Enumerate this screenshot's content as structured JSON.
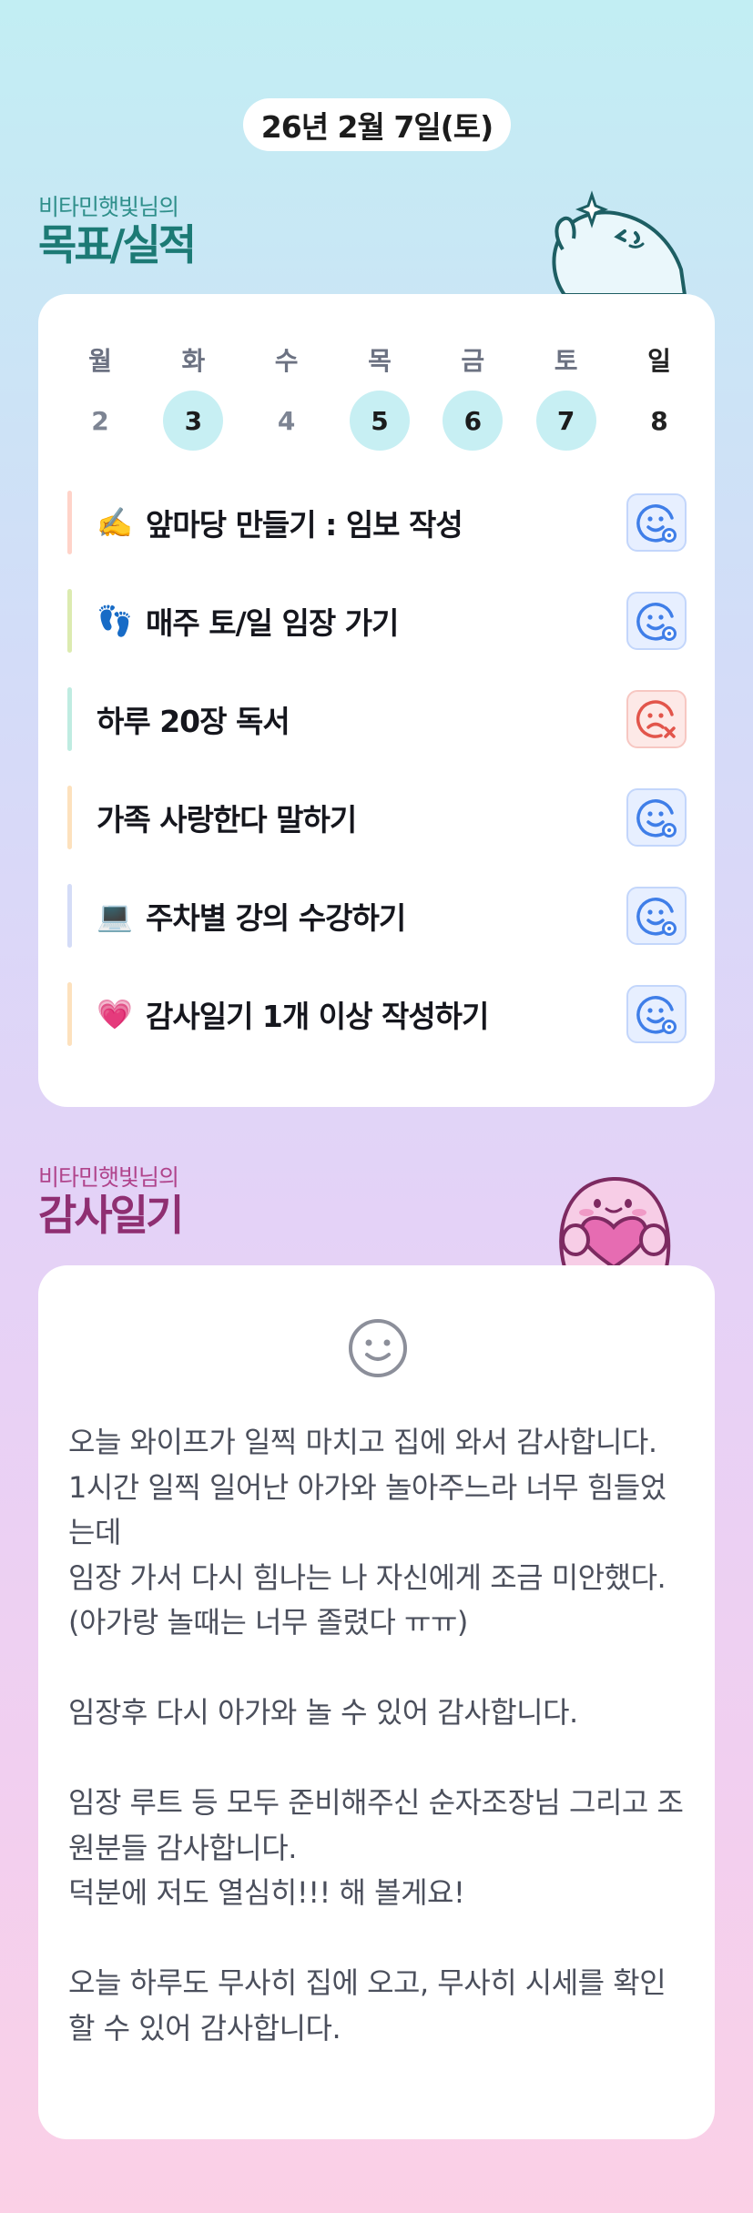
{
  "date_label": "26년 2월 7일(토)",
  "goals_section": {
    "subtitle": "비타민햇빛님의",
    "title": "목표/실적"
  },
  "week": {
    "days": [
      {
        "weekday": "월",
        "date": "2",
        "done": false
      },
      {
        "weekday": "화",
        "date": "3",
        "done": true
      },
      {
        "weekday": "수",
        "date": "4",
        "done": false
      },
      {
        "weekday": "목",
        "date": "5",
        "done": true
      },
      {
        "weekday": "금",
        "date": "6",
        "done": true
      },
      {
        "weekday": "토",
        "date": "7",
        "done": true
      },
      {
        "weekday": "일",
        "date": "8",
        "done": false
      }
    ]
  },
  "goals": [
    {
      "emoji": "✍️",
      "text": "앞마당 만들기 : 임보 작성",
      "status": "done",
      "bar_color": "#ffd3c9"
    },
    {
      "emoji": "👣",
      "text": "매주 토/일 임장 가기",
      "status": "done",
      "bar_color": "#dcebb0"
    },
    {
      "emoji": "",
      "text": "하루 20장 독서",
      "status": "failed",
      "bar_color": "#bfece1"
    },
    {
      "emoji": "",
      "text": "가족 사랑한다 말하기",
      "status": "done",
      "bar_color": "#fde1bd"
    },
    {
      "emoji": "💻",
      "text": "주차별 강의 수강하기",
      "status": "done",
      "bar_color": "#d4dcf7"
    },
    {
      "emoji": "💗",
      "text": "감사일기 1개 이상 작성하기",
      "status": "done",
      "bar_color": "#fde1bd"
    }
  ],
  "diary_section": {
    "subtitle": "비타민햇빛님의",
    "title": "감사일기"
  },
  "diary_text": "오늘 와이프가 일찍 마치고 집에 와서 감사합니다.\n1시간 일찍 일어난 아가와 놀아주느라 너무 힘들었는데\n임장 가서 다시 힘나는 나 자신에게 조금 미안했다.\n(아가랑 놀때는 너무 졸렸다 ㅠㅠ)\n\n임장후 다시 아가와 놀 수 있어 감사합니다.\n\n임장 루트 등 모두 준비해주신 순자조장님 그리고 조원분들 감사합니다.\n덕분에 저도 열심히!!! 해 볼게요!\n\n오늘 하루도 무사히 집에 오고, 무사히 시세를 확인할 수 있어 감사합니다.",
  "colors": {
    "teal_title": "#1c7a75",
    "plum_title": "#8f2f72",
    "done_circle": "#c7eff3",
    "ok_icon": "#3f7ee8",
    "fail_icon": "#e2554b"
  },
  "icons": {
    "ok": "smile-check-icon",
    "fail": "frown-x-icon",
    "diary": "smiley-icon"
  }
}
